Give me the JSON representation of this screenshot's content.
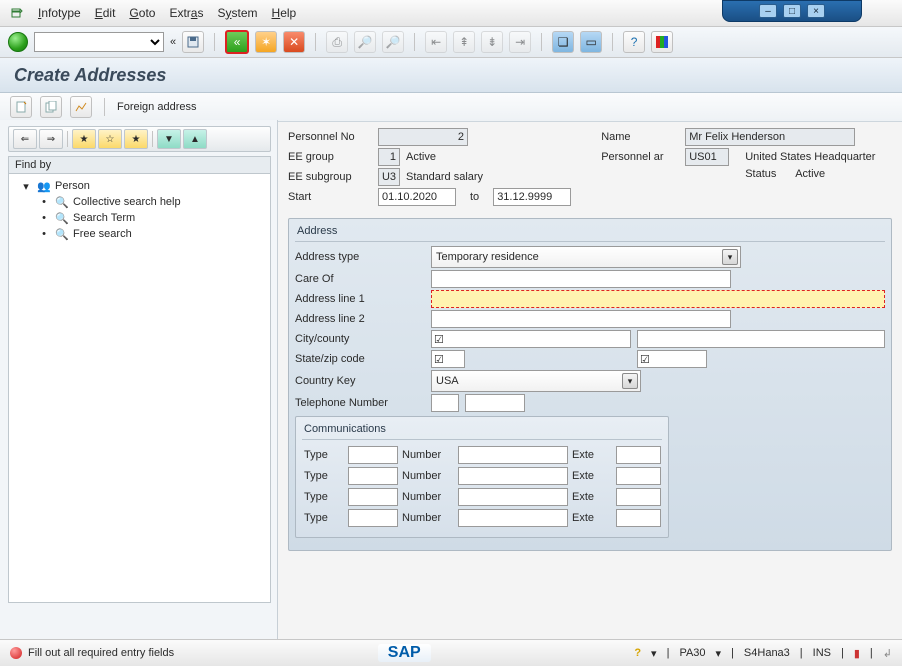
{
  "window": {
    "minimize": "–",
    "maximize": "□",
    "close": "×"
  },
  "menu": {
    "items": [
      "Infotype",
      "Edit",
      "Goto",
      "Extras",
      "System",
      "Help"
    ]
  },
  "page_title": "Create Addresses",
  "subtoolbar": {
    "foreign_address": "Foreign address"
  },
  "sidebar": {
    "find_by": "Find by",
    "items": [
      {
        "label": "Person"
      },
      {
        "label": "Collective search help"
      },
      {
        "label": "Search Term"
      },
      {
        "label": "Free search"
      }
    ]
  },
  "header": {
    "personnel_no_label": "Personnel No",
    "personnel_no": "2",
    "name_label": "Name",
    "name": "Mr Felix Henderson",
    "ee_group_label": "EE group",
    "ee_group": "1",
    "ee_group_text": "Active",
    "personnel_area_label": "Personnel ar",
    "personnel_area": "US01",
    "personnel_area_text": "United States Headquarter",
    "ee_subgroup_label": "EE subgroup",
    "ee_subgroup": "U3",
    "ee_subgroup_text": "Standard salary",
    "status_label": "Status",
    "status_text": "Active",
    "start_label": "Start",
    "start": "01.10.2020",
    "to_label": "to",
    "end": "31.12.9999"
  },
  "address": {
    "group_title": "Address",
    "type_label": "Address type",
    "type_value": "Temporary residence",
    "careof_label": "Care Of",
    "careof_value": "",
    "line1_label": "Address line 1",
    "line1_value": "",
    "line2_label": "Address line 2",
    "line2_value": "",
    "city_label": "City/county",
    "city_value": "",
    "county_value": "",
    "state_label": "State/zip code",
    "state_value": "",
    "zip_value": "",
    "country_label": "Country Key",
    "country_value": "USA",
    "phone_label": "Telephone Number",
    "phone_a": "",
    "phone_b": "",
    "check_glyph": "☑"
  },
  "comm": {
    "group_title": "Communications",
    "type_label": "Type",
    "number_label": "Number",
    "ext_label": "Exte",
    "rows": [
      {
        "type": "",
        "number": "",
        "ext": ""
      },
      {
        "type": "",
        "number": "",
        "ext": ""
      },
      {
        "type": "",
        "number": "",
        "ext": ""
      },
      {
        "type": "",
        "number": "",
        "ext": ""
      }
    ]
  },
  "statusbar": {
    "message": "Fill out all required entry fields",
    "sap": "SAP",
    "transaction": "PA30",
    "system": "S4Hana3",
    "ins": "INS"
  }
}
